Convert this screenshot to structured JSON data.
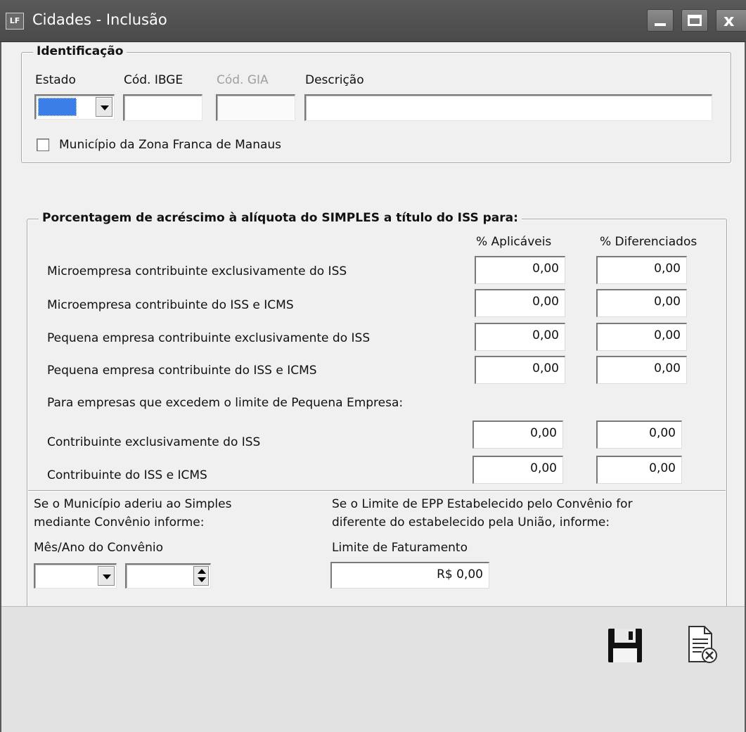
{
  "window": {
    "title": "Cidades - Inclusão",
    "icon_text": "LF"
  },
  "identificacao": {
    "legend": "Identificação",
    "estado_label": "Estado",
    "cod_ibge_label": "Cód. IBGE",
    "cod_gia_label": "Cód. GIA",
    "descricao_label": "Descrição",
    "estado_value": "",
    "cod_ibge_value": "",
    "cod_gia_value": "",
    "descricao_value": "",
    "zona_franca_label": "Município da Zona Franca de Manaus"
  },
  "porcentagem": {
    "legend": "Porcentagem de acréscimo à alíquota do SIMPLES a título do ISS para:",
    "col_aplicaveis": "% Aplicáveis",
    "col_diferenciados": "% Diferenciados",
    "rows": [
      {
        "label": "Microempresa contribuinte exclusivamente do ISS",
        "aplicaveis": "0,00",
        "diferenciados": "0,00"
      },
      {
        "label": "Microempresa contribuinte do ISS e ICMS",
        "aplicaveis": "0,00",
        "diferenciados": "0,00"
      },
      {
        "label": "Pequena  empresa contribuinte exclusivamente do ISS",
        "aplicaveis": "0,00",
        "diferenciados": "0,00"
      },
      {
        "label": "Pequena  empresa contribuinte do ISS e ICMS",
        "aplicaveis": "0,00",
        "diferenciados": "0,00"
      }
    ],
    "excedem_label": "Para empresas que excedem o limite de Pequena Empresa:",
    "excedem_rows": [
      {
        "label": "Contribuinte exclusivamente do ISS",
        "aplicaveis": "0,00",
        "diferenciados": "0,00"
      },
      {
        "label": "Contribuinte do  ISS e ICMS",
        "aplicaveis": "0,00",
        "diferenciados": "0,00"
      }
    ]
  },
  "convenio": {
    "line1": "Se o Município aderiu ao Simples",
    "line2": "mediante Convênio  informe:",
    "mes_ano_label": "Mês/Ano do Convênio",
    "mes_value": "",
    "ano_value": ""
  },
  "limite": {
    "line1": "Se o Limite de EPP Estabelecido pelo Convênio for",
    "line2": "diferente do estabelecido pela União, informe:",
    "faturamento_label": "Limite de Faturamento",
    "faturamento_value": "R$ 0,00"
  },
  "icons": {
    "save": "floppy-disk-icon",
    "cancel": "document-cancel-icon"
  },
  "colors": {
    "titlebar": "#4e4e4e",
    "dialog_bg": "#f0f0f0",
    "footer_bg": "#e2e2e2",
    "focus_fill": "#3b7ee8"
  }
}
